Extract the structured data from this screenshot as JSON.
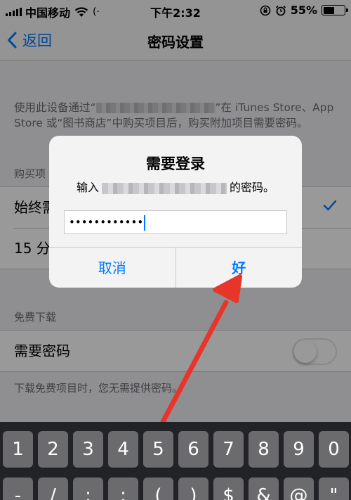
{
  "status_bar": {
    "carrier": "中国移动",
    "time": "下午2:32",
    "battery_percent": "55%",
    "battery_level": 0.55,
    "loading_glyph": "(·"
  },
  "nav": {
    "back_label": "返回",
    "title": "密码设置"
  },
  "settings": {
    "description_part1": "使用此设备通过“",
    "description_part2": "”在 iTunes Store、App Store 或“图书商店”中购买项目后，购买附加项目需要密码。",
    "purchase_section_header": "购买项",
    "purchase_options": [
      "始终需",
      "15 分"
    ],
    "free_section_header": "免费下载",
    "require_password_label": "需要密码",
    "require_password_on": false,
    "footer": "下载免费项目时，您无需提供密码。"
  },
  "alert": {
    "title": "需要登录",
    "message_prefix": "输入",
    "message_suffix": "的密码。",
    "password_value": "••••••••••••",
    "cancel_label": "取消",
    "ok_label": "好"
  },
  "keyboard": {
    "row1": [
      "1",
      "2",
      "3",
      "4",
      "5",
      "6",
      "7",
      "8",
      "9",
      "0"
    ],
    "row2": [
      "-",
      "/",
      ":",
      ";",
      "(",
      ")",
      "$",
      "&",
      "@",
      "\""
    ]
  },
  "colors": {
    "accent": "#007aff",
    "arrow": "#e8352a"
  }
}
